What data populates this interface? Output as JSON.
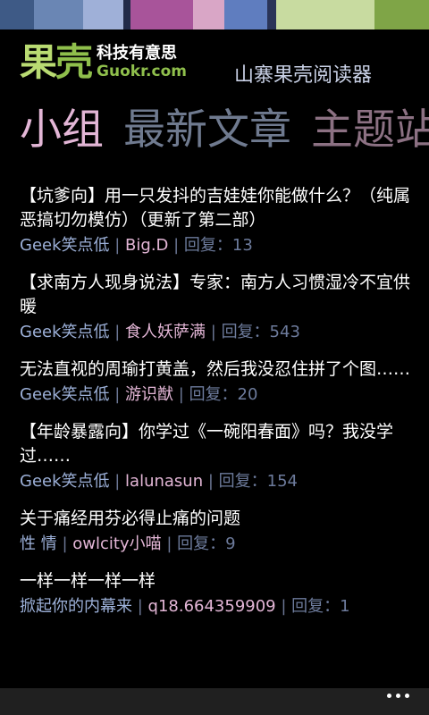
{
  "header": {
    "logo_main_1": "果",
    "logo_main_2": "壳",
    "logo_cn": "科技有意思",
    "logo_en": "Guokr.com",
    "app_title": "山寨果壳阅读器"
  },
  "tabs": [
    {
      "label": "小组",
      "active": true
    },
    {
      "label": "最新文章",
      "active": false
    },
    {
      "label": "主题站",
      "active": false
    }
  ],
  "posts": [
    {
      "title": "【坑爹向】用一只发抖的吉娃娃你能做什么？（纯属恶搞切勿模仿）（更新了第二部）",
      "category": "Geek笑点低",
      "author": "Big.D",
      "reply": "回复：13"
    },
    {
      "title": "【求南方人现身说法】专家：南方人习惯湿冷不宜供暖",
      "category": "Geek笑点低",
      "author": "食人妖萨满",
      "reply": "回复：543"
    },
    {
      "title": "无法直视的周瑜打黄盖，然后我没忍住拼了个图……",
      "category": "Geek笑点低",
      "author": "游识猷",
      "reply": "回复：20"
    },
    {
      "title": "【年龄暴露向】你学过《一碗阳春面》吗？我没学过……",
      "category": "Geek笑点低",
      "author": "lalunasun",
      "reply": "回复：154"
    },
    {
      "title": "关于痛经用芬必得止痛的问题",
      "category": "性 情",
      "author": "owlcity小喵",
      "reply": "回复：9"
    },
    {
      "title": "一样一样一样一样",
      "category": "掀起你的内幕来",
      "author": "q18.664359909",
      "reply": "回复：1"
    }
  ],
  "separator": " | ",
  "appbar": {
    "more_icon": "ellipsis-icon"
  },
  "colors": {
    "accent_pink": "#e3b6d6",
    "category_blue": "#9cb0d8",
    "logo_green": "#8fbf4c"
  }
}
